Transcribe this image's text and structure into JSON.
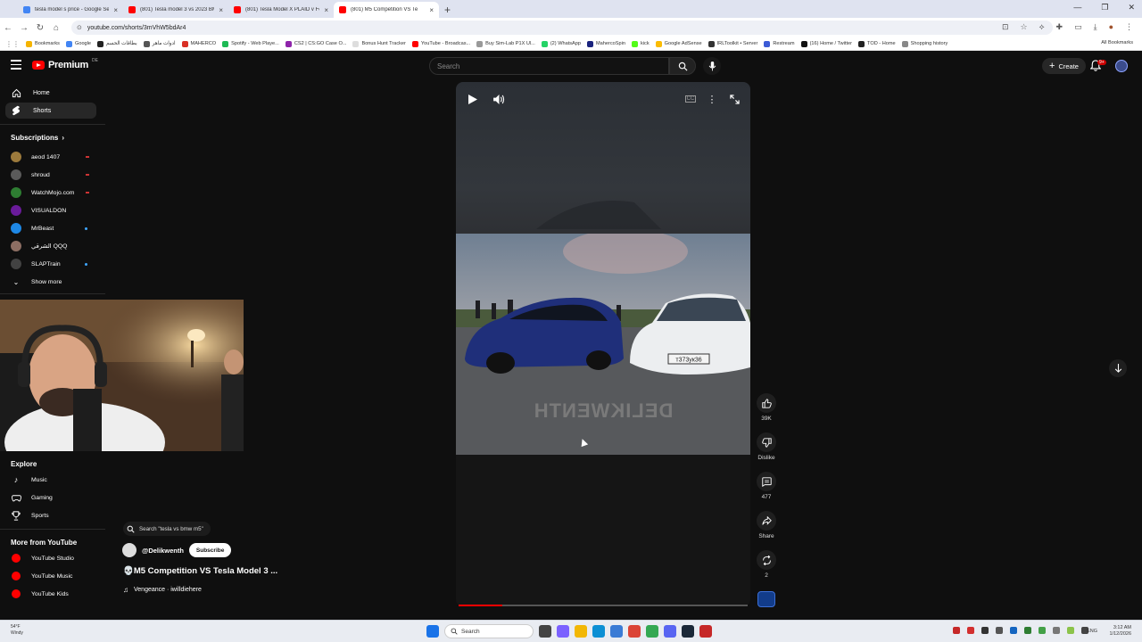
{
  "browser": {
    "tabs": [
      {
        "title": "tesla model s price - Google Se",
        "favicon_color": "#4285f4",
        "active": false
      },
      {
        "title": "(801) Tesla model 3 vs 2023 BM",
        "favicon_color": "#ff0000",
        "active": false
      },
      {
        "title": "(801) Tesla Model X PLAID v Fe",
        "favicon_color": "#ff0000",
        "active": false
      },
      {
        "title": "(801) M5 Competition VS Te",
        "favicon_color": "#ff0000",
        "active": true
      }
    ],
    "url": "youtube.com/shorts/3mVhW5bdAr4",
    "bookmarks": [
      {
        "label": "Bookmarks",
        "color": "#f5b400"
      },
      {
        "label": "Google",
        "color": "#4285f4"
      },
      {
        "label": "بطاقات الحسم",
        "color": "#222222"
      },
      {
        "label": "ادوات ماهر",
        "color": "#555555"
      },
      {
        "label": "MAHERCO",
        "color": "#d93025"
      },
      {
        "label": "Spotify - Web Playe...",
        "color": "#1db954"
      },
      {
        "label": "CS2 | CS:GO Case O...",
        "color": "#8e24aa"
      },
      {
        "label": "Bonus Hunt Tracker",
        "color": "#dddddd"
      },
      {
        "label": "YouTube - Broadcas...",
        "color": "#ff0000"
      },
      {
        "label": "Buy Sim-Lab P1X Ul...",
        "color": "#999999"
      },
      {
        "label": "(2) WhatsApp",
        "color": "#25d366"
      },
      {
        "label": "MahercoSpin",
        "color": "#1a237e"
      },
      {
        "label": "kick",
        "color": "#53fc18"
      },
      {
        "label": "Google AdSense",
        "color": "#fbbc04"
      },
      {
        "label": "IRLToolkit • Server",
        "color": "#333333"
      },
      {
        "label": "Restream",
        "color": "#3c5bd6"
      },
      {
        "label": "(16) Home / Twitter",
        "color": "#111111"
      },
      {
        "label": "TOD - Home",
        "color": "#222222"
      },
      {
        "label": "Shopping history",
        "color": "#888888"
      }
    ],
    "all_bookmarks": "All Bookmarks"
  },
  "masthead": {
    "brand": "Premium",
    "country_code": "DE",
    "search_placeholder": "Search",
    "create_label": "Create",
    "notif_badge": "9+"
  },
  "sidebar": {
    "main": [
      {
        "label": "Home",
        "icon": "home-icon",
        "active": false
      },
      {
        "label": "Shorts",
        "icon": "shorts-icon",
        "active": true
      }
    ],
    "subscriptions_title": "Subscriptions",
    "subscriptions": [
      {
        "label": "aeod 1407",
        "color": "#9c7a3c",
        "indicator": "live"
      },
      {
        "label": "shroud",
        "color": "#5a5a5a",
        "indicator": "live"
      },
      {
        "label": "WatchMojo.com",
        "color": "#2e7d32",
        "indicator": "live"
      },
      {
        "label": "VISUALDON",
        "color": "#6a1b9a",
        "indicator": "none"
      },
      {
        "label": "MrBeast",
        "color": "#1e88e5",
        "indicator": "new"
      },
      {
        "label": "الشرقي QQQ",
        "color": "#8d6e63",
        "indicator": "none"
      },
      {
        "label": "SLAPTrain",
        "color": "#424242",
        "indicator": "new"
      }
    ],
    "show_more": "Show more",
    "explore_title": "Explore",
    "explore": [
      {
        "label": "Music",
        "icon": "music-icon"
      },
      {
        "label": "Gaming",
        "icon": "gaming-icon"
      },
      {
        "label": "Sports",
        "icon": "trophy-icon"
      }
    ],
    "more_title": "More from YouTube",
    "more": [
      {
        "label": "YouTube Studio"
      },
      {
        "label": "YouTube Music"
      },
      {
        "label": "YouTube Kids"
      }
    ]
  },
  "short": {
    "search_chip": "Search \"tesla vs bmw m5\"",
    "channel": "@Delikwenth",
    "subscribe_label": "Subscribe",
    "title": "💀M5 Competition VS Tesla Model 3 ...",
    "music": "Vengeance · iwilldiehere",
    "watermark": "DELIKWENTH",
    "progress": 0.15,
    "likes": "39K",
    "dislike_label": "Dislike",
    "comments": "477",
    "share_label": "Share",
    "remix_count": "2"
  },
  "taskbar": {
    "weather_temp": "54°F",
    "weather_text": "Windy",
    "search_label": "Search",
    "lang": "ENG",
    "time": "3:12 AM",
    "date": "1/12/2026"
  }
}
